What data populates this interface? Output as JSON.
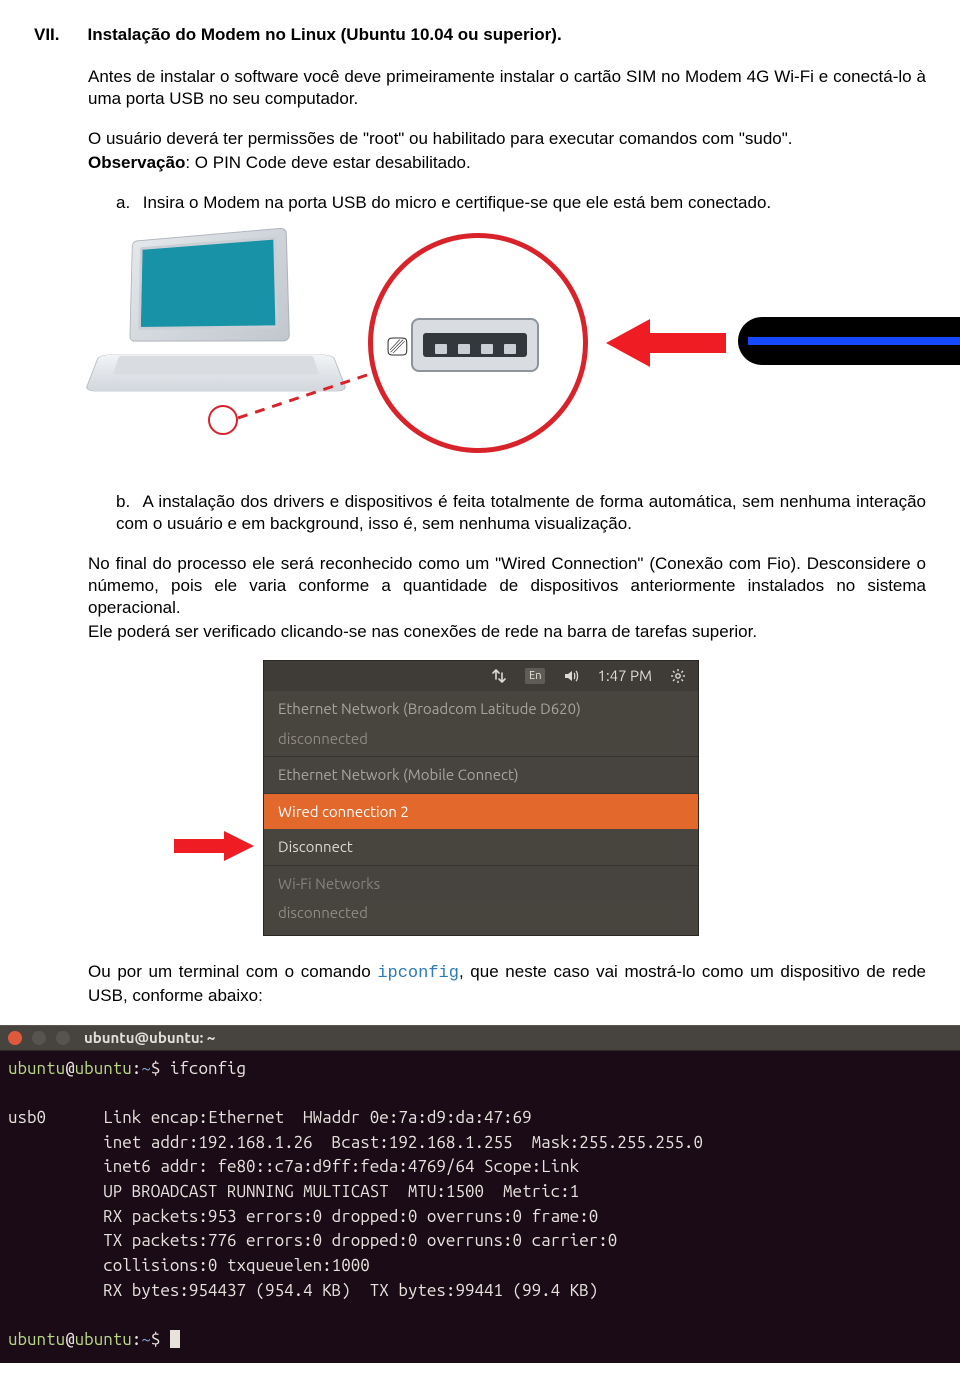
{
  "section": {
    "number": "VII.",
    "title": "Instalação do Modem no Linux (Ubuntu 10.04 ou superior)."
  },
  "intro": {
    "p1": "Antes de instalar o software você deve primeiramente instalar o cartão SIM no Modem 4G Wi-Fi e conectá-lo à uma porta USB no seu computador.",
    "p2": "O usuário deverá ter permissões de \"root\" ou habilitado para executar comandos com \"sudo\".",
    "obs_label": "Observação",
    "obs_text": ": O PIN Code deve estar desabilitado."
  },
  "steps": {
    "a_marker": "a.",
    "a_text": "Insira o Modem na porta USB do micro e certifique-se que ele está bem conectado.",
    "b_marker": "b.",
    "b_text": "A instalação dos drivers e dispositivos é feita totalmente de forma automática, sem nenhuma interação com o usuário e em background, isso é, sem nenhuma visualização."
  },
  "para_after_b": {
    "l1": "No final do processo ele será reconhecido como um \"Wired Connection\" (Conexão com Fio). Desconsidere o númemo, pois ele varia conforme a quantidade de dispositivos anteriormente instalados no sistema operacional.",
    "l2": "Ele poderá ser verificado clicando-se nas conexões de rede na barra de tarefas superior."
  },
  "netmenu": {
    "topbar": {
      "lang": "En",
      "time": "1:47 PM"
    },
    "items": {
      "eth1_head": "Ethernet Network (Broadcom Latitude D620)",
      "eth1_sub": "disconnected",
      "eth2_head": "Ethernet Network (Mobile Connect)",
      "wired_sel": "Wired connection 2",
      "disconnect": "Disconnect",
      "wifi_head": "Wi-Fi Networks",
      "wifi_sub": "disconnected"
    }
  },
  "para_terminal": {
    "pre": "Ou por um terminal com o comando ",
    "cmd": "ipconfig",
    "post": ", que neste caso vai mostrá-lo como um dispositivo de rede USB, conforme abaixo:"
  },
  "terminal": {
    "title": "ubuntu@ubuntu: ~",
    "prompt": {
      "user": "ubuntu",
      "host": "ubuntu",
      "path": "~"
    },
    "cmd": "ifconfig",
    "iface": "usb0",
    "lines": [
      "Link encap:Ethernet  HWaddr 0e:7a:d9:da:47:69",
      "inet addr:192.168.1.26  Bcast:192.168.1.255  Mask:255.255.255.0",
      "inet6 addr: fe80::c7a:d9ff:feda:4769/64 Scope:Link",
      "UP BROADCAST RUNNING MULTICAST  MTU:1500  Metric:1",
      "RX packets:953 errors:0 dropped:0 overruns:0 frame:0",
      "TX packets:776 errors:0 dropped:0 overruns:0 carrier:0",
      "collisions:0 txqueuelen:1000",
      "RX bytes:954437 (954.4 KB)  TX bytes:99441 (99.4 KB)"
    ]
  }
}
